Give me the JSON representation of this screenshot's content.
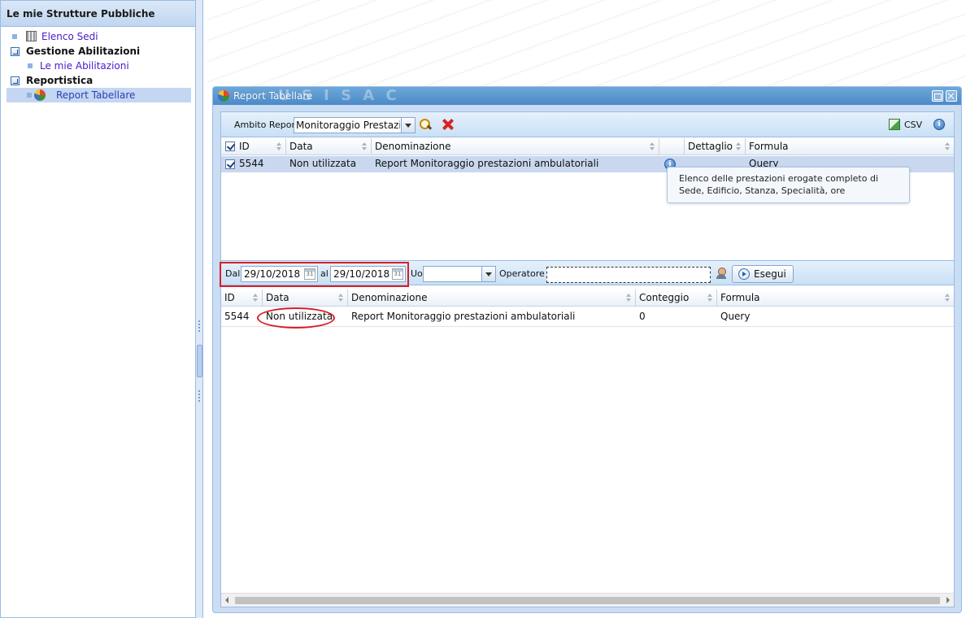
{
  "sidebar": {
    "title": "Le mie Strutture Pubbliche",
    "items": [
      {
        "label": "Elenco Sedi"
      },
      {
        "label": "Gestione Abilitazioni"
      },
      {
        "label": "Le mie Abilitazioni"
      },
      {
        "label": "Reportistica"
      },
      {
        "label": "Report Tabellare"
      }
    ]
  },
  "watermark": "U S I S A C",
  "window": {
    "title": "Report Tabellare",
    "toolbar": {
      "ambito_label": "Ambito Report",
      "ambito_value": "Monitoraggio Prestazioni",
      "csv_label": "CSV"
    },
    "top_grid": {
      "columns": [
        "ID",
        "Data",
        "Denominazione",
        "",
        "Dettaglio",
        "Formula"
      ],
      "rows": [
        {
          "id": "5544",
          "data": "Non utilizzata",
          "denominazione": "Report Monitoraggio prestazioni ambulatoriali",
          "formula": "Query"
        }
      ],
      "tooltip_line1": "Elenco delle prestazioni erogate completo di",
      "tooltip_line2": "Sede, Edificio, Stanza, Specialità, ore"
    },
    "filter_bar": {
      "dal_label": "Dal",
      "dal_value": "29/10/2018",
      "al_label": "al",
      "al_value": "29/10/2018",
      "uo_label": "Uo",
      "uo_value": "",
      "operatore_label": "Operatore",
      "operatore_value": "",
      "esegui_label": "Esegui",
      "calendar_glyph": "31"
    },
    "bottom_grid": {
      "columns": [
        "ID",
        "Data",
        "Denominazione",
        "Conteggio",
        "Formula"
      ],
      "rows": [
        {
          "id": "5544",
          "data": "Non utilizzata",
          "denominazione": "Report Monitoraggio prestazioni ambulatoriali",
          "conteggio": "0",
          "formula": "Query"
        }
      ]
    }
  }
}
